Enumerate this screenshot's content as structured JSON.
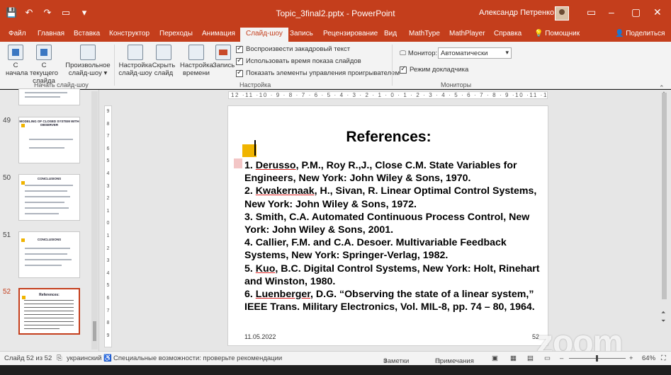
{
  "titlebar": {
    "doc_title": "Topic_3final2.pptx  -  PowerPoint",
    "user": "Александр Петренко"
  },
  "tabs": [
    "Файл",
    "Главная",
    "Вставка",
    "Конструктор",
    "Переходы",
    "Анимация",
    "Слайд-шоу",
    "Запись",
    "Рецензирование",
    "Вид",
    "MathType",
    "MathPlayer",
    "Справка",
    "Помощник"
  ],
  "share_label": "Поделиться",
  "ribbon": {
    "start_group": {
      "label": "Начать слайд-шоу",
      "from_start_1": "С",
      "from_start_2": "начала",
      "from_current_1": "С текущего",
      "from_current_2": "слайда",
      "custom_1": "Произвольное",
      "custom_2": "слайд-шоу"
    },
    "setup_group": {
      "label": "Настройка",
      "setup_1": "Настройка",
      "setup_2": "слайд-шоу",
      "hide_1": "Скрыть",
      "hide_2": "слайд",
      "rehearse_1": "Настройка",
      "rehearse_2": "времени",
      "record": "Запись",
      "check1": "Воспроизвести закадровый текст",
      "check2": "Использовать время показа слайдов",
      "check3": "Показать элементы управления проигрывателем"
    },
    "monitors_group": {
      "label": "Мониторы",
      "monitor_label": "Монитор:",
      "monitor_value": "Автоматически",
      "presenter_view": "Режим докладчика"
    }
  },
  "ruler": {
    "horizontal": "12 ·11 ·10 · 9 · 8 · 7 · 6 · 5 · 4 · 3 · 2 · 1 · 0 · 1 · 2 · 3 · 4 · 5 · 6 · 7 · 8 · 9 ·10 ·11 ·12",
    "vertical": [
      "9",
      "8",
      "7",
      "6",
      "5",
      "4",
      "3",
      "2",
      "1",
      "0",
      "1",
      "2",
      "3",
      "4",
      "5",
      "6",
      "7",
      "8",
      "9"
    ]
  },
  "thumbnails": [
    {
      "num": "49",
      "title": "MODELING OF CLOSED SYSTEM WITH OBSERVER"
    },
    {
      "num": "50",
      "title": "CONCLUSIONS"
    },
    {
      "num": "51",
      "title": "CONCLUSIONS"
    },
    {
      "num": "52",
      "title": "References:"
    }
  ],
  "slide": {
    "title": "References:",
    "refs": [
      {
        "n": "1. ",
        "u": "Derusso",
        "rest": ", P.M., Roy R.,J., Close C.M. State Variables for Engineers, New York: John Wiley & Sons, 1970."
      },
      {
        "n": "2. ",
        "u": "Kwakernaak",
        "rest": ", H., Sivan, R. Linear Optimal Control Systems, New York: John Wiley & Sons, 1972."
      },
      {
        "n": "3. ",
        "u": "",
        "rest": "Smith, C.A. Automated Continuous Process Control, New York: John Wiley & Sons, 2001."
      },
      {
        "n": "4. ",
        "u": "",
        "rest": "Callier, F.M. and C.A. Desoer. Multivariable Feedback Systems, New York: Springer-Verlag, 1982."
      },
      {
        "n": "5. ",
        "u": "Kuo",
        "rest": ", B.C. Digital Control Systems, New York: Holt, Rinehart and Winston, 1980."
      },
      {
        "n": "6. ",
        "u": "Luenberger",
        "rest": ", D.G. “Observing the state of a linear system,” IEEE Trans. Military Electronics, Vol. MIL-8, pp. 74 – 80, 1964."
      }
    ],
    "date": "11.05.2022",
    "number": "52"
  },
  "watermark": "zoom",
  "status": {
    "slide_counter": "Слайд 52 из 52",
    "language": "украинский",
    "accessibility": "Специальные возможности: проверьте рекомендации",
    "notes": "Заметки",
    "comments": "Примечания",
    "zoom": "64%"
  },
  "colors": {
    "accent": "#c43e1c",
    "ribbon_bg": "#f3f3f3",
    "slide_bg": "#ffffff"
  }
}
